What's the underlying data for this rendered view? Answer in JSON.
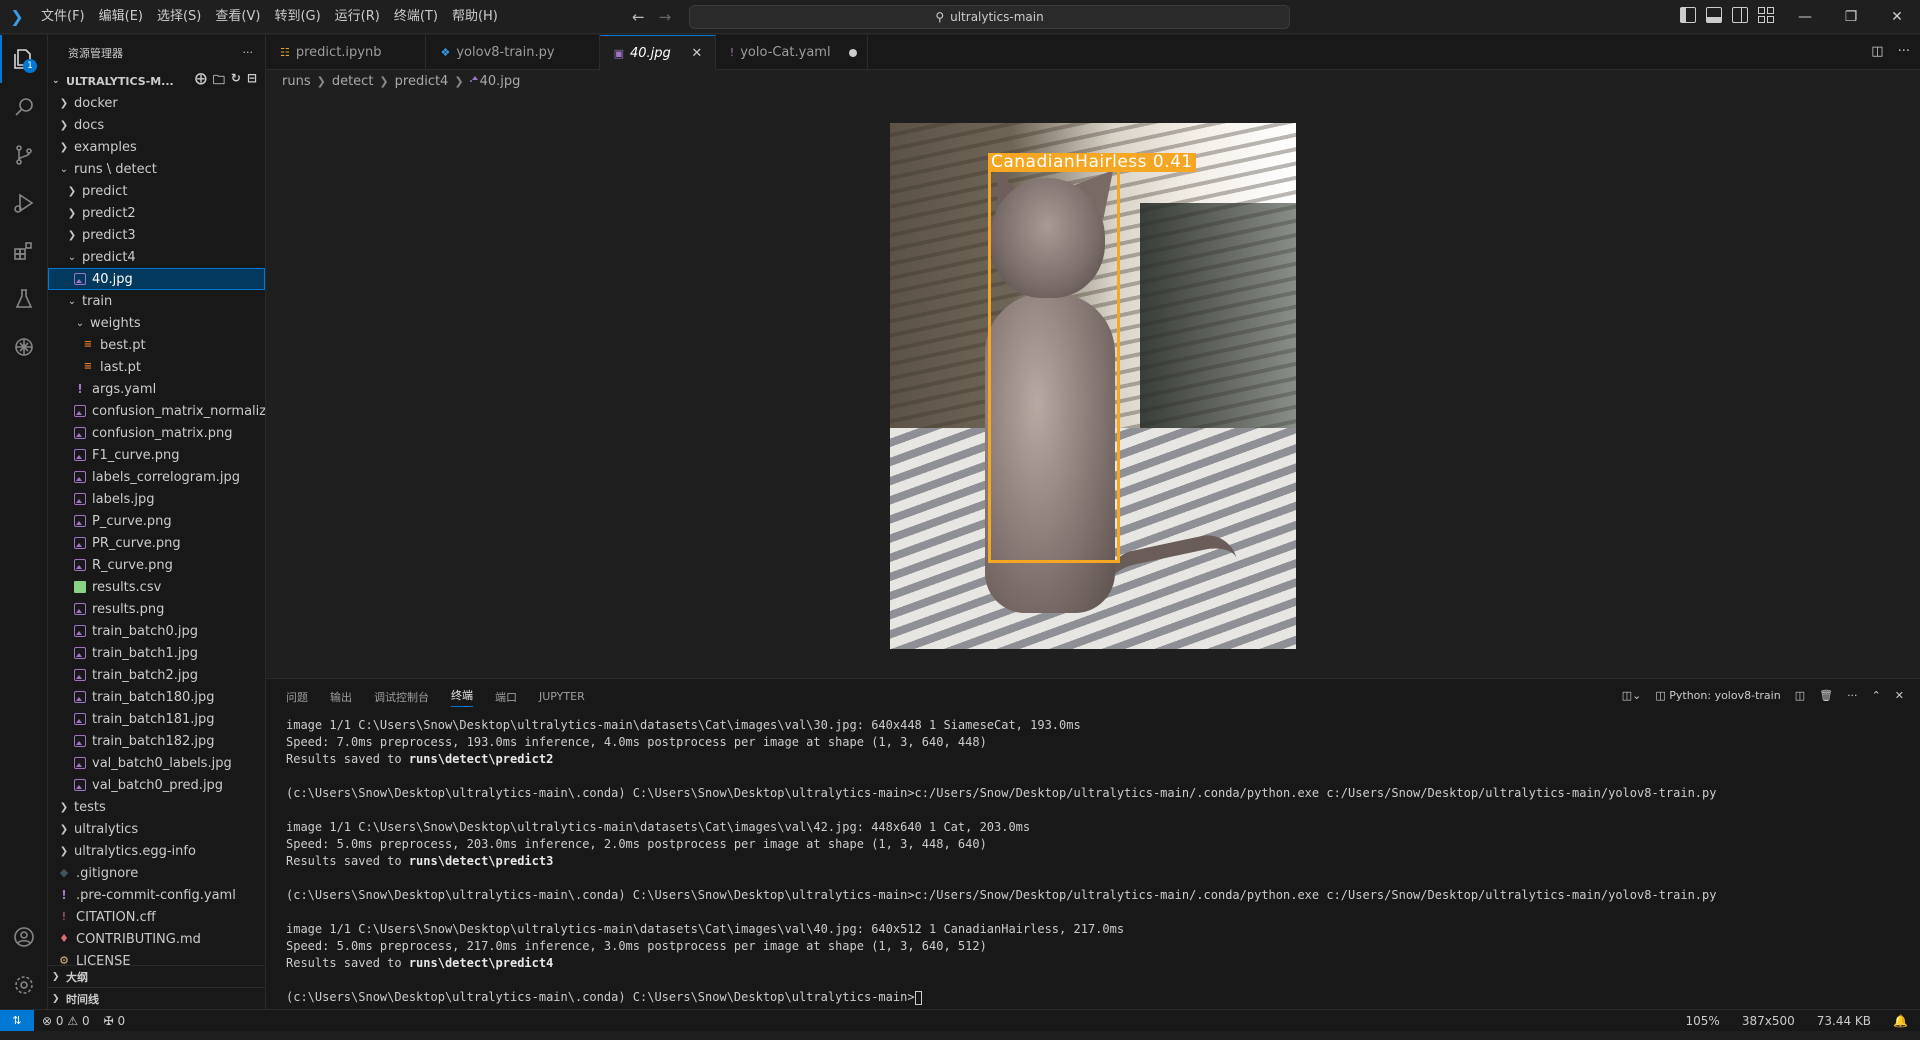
{
  "titlebar": {
    "menu": [
      "文件(F)",
      "编辑(E)",
      "选择(S)",
      "查看(V)",
      "转到(G)",
      "运行(R)",
      "终端(T)",
      "帮助(H)"
    ],
    "search_text": "ultralytics-main"
  },
  "activity": {
    "explorer_badge": "1"
  },
  "sidebar": {
    "header": "资源管理器",
    "root": "ULTRALYTICS-M...",
    "items": [
      {
        "label": "docker",
        "depth": 0,
        "type": "folder",
        "open": false
      },
      {
        "label": "docs",
        "depth": 0,
        "type": "folder",
        "open": false
      },
      {
        "label": "examples",
        "depth": 0,
        "type": "folder",
        "open": false
      },
      {
        "label": "runs \\ detect",
        "depth": 0,
        "type": "folder",
        "open": true
      },
      {
        "label": "predict",
        "depth": 1,
        "type": "folder",
        "open": false
      },
      {
        "label": "predict2",
        "depth": 1,
        "type": "folder",
        "open": false
      },
      {
        "label": "predict3",
        "depth": 1,
        "type": "folder",
        "open": false
      },
      {
        "label": "predict4",
        "depth": 1,
        "type": "folder",
        "open": true
      },
      {
        "label": "40.jpg",
        "depth": 2,
        "type": "img",
        "selected": true
      },
      {
        "label": "train",
        "depth": 1,
        "type": "folder",
        "open": true
      },
      {
        "label": "weights",
        "depth": 2,
        "type": "folder",
        "open": true
      },
      {
        "label": "best.pt",
        "depth": 3,
        "type": "pt"
      },
      {
        "label": "last.pt",
        "depth": 3,
        "type": "pt"
      },
      {
        "label": "args.yaml",
        "depth": 2,
        "type": "yaml"
      },
      {
        "label": "confusion_matrix_normaliz...",
        "depth": 2,
        "type": "img"
      },
      {
        "label": "confusion_matrix.png",
        "depth": 2,
        "type": "img"
      },
      {
        "label": "F1_curve.png",
        "depth": 2,
        "type": "img"
      },
      {
        "label": "labels_correlogram.jpg",
        "depth": 2,
        "type": "img"
      },
      {
        "label": "labels.jpg",
        "depth": 2,
        "type": "img"
      },
      {
        "label": "P_curve.png",
        "depth": 2,
        "type": "img"
      },
      {
        "label": "PR_curve.png",
        "depth": 2,
        "type": "img"
      },
      {
        "label": "R_curve.png",
        "depth": 2,
        "type": "img"
      },
      {
        "label": "results.csv",
        "depth": 2,
        "type": "csv"
      },
      {
        "label": "results.png",
        "depth": 2,
        "type": "img"
      },
      {
        "label": "train_batch0.jpg",
        "depth": 2,
        "type": "img"
      },
      {
        "label": "train_batch1.jpg",
        "depth": 2,
        "type": "img"
      },
      {
        "label": "train_batch2.jpg",
        "depth": 2,
        "type": "img"
      },
      {
        "label": "train_batch180.jpg",
        "depth": 2,
        "type": "img"
      },
      {
        "label": "train_batch181.jpg",
        "depth": 2,
        "type": "img"
      },
      {
        "label": "train_batch182.jpg",
        "depth": 2,
        "type": "img"
      },
      {
        "label": "val_batch0_labels.jpg",
        "depth": 2,
        "type": "img"
      },
      {
        "label": "val_batch0_pred.jpg",
        "depth": 2,
        "type": "img"
      },
      {
        "label": "tests",
        "depth": 0,
        "type": "folder",
        "open": false
      },
      {
        "label": "ultralytics",
        "depth": 0,
        "type": "folder",
        "open": false
      },
      {
        "label": "ultralytics.egg-info",
        "depth": 0,
        "type": "folder",
        "open": false
      },
      {
        "label": ".gitignore",
        "depth": 0,
        "type": "git"
      },
      {
        "label": ".pre-commit-config.yaml",
        "depth": 0,
        "type": "yaml"
      },
      {
        "label": "CITATION.cff",
        "depth": 0,
        "type": "cff"
      },
      {
        "label": "CONTRIBUTING.md",
        "depth": 0,
        "type": "md"
      },
      {
        "label": "LICENSE",
        "depth": 0,
        "type": "lic"
      }
    ],
    "outline": "大纲",
    "timeline": "时间线"
  },
  "tabs": [
    {
      "label": "predict.ipynb",
      "icon": "notebook-icon",
      "active": false,
      "dirty": false
    },
    {
      "label": "yolov8-train.py",
      "icon": "python-icon",
      "active": false,
      "dirty": false
    },
    {
      "label": "40.jpg",
      "icon": "image-icon",
      "active": true,
      "dirty": false
    },
    {
      "label": "yolo-Cat.yaml",
      "icon": "yaml-icon",
      "active": false,
      "dirty": true
    }
  ],
  "breadcrumb": [
    "runs",
    "detect",
    "predict4",
    "40.jpg"
  ],
  "image": {
    "detection_label": "CanadianHairless  0.41",
    "bbox_color": "#f5a623"
  },
  "panel": {
    "tabs": [
      "问题",
      "输出",
      "调试控制台",
      "终端",
      "端口",
      "JUPYTER"
    ],
    "active_tab": "终端",
    "terminal_name": "Python: yolov8-train",
    "lines": [
      {
        "text": "image 1/1 C:\\Users\\Snow\\Desktop\\ultralytics-main\\datasets\\Cat\\images\\val\\30.jpg: 640x448 1 SiameseCat, 193.0ms"
      },
      {
        "text": "Speed: 7.0ms preprocess, 193.0ms inference, 4.0ms postprocess per image at shape (1, 3, 640, 448)"
      },
      {
        "text": "Results saved to ",
        "bold": "runs\\detect\\predict2"
      },
      {
        "text": ""
      },
      {
        "text": "(c:\\Users\\Snow\\Desktop\\ultralytics-main\\.conda) C:\\Users\\Snow\\Desktop\\ultralytics-main>c:/Users/Snow/Desktop/ultralytics-main/.conda/python.exe c:/Users/Snow/Desktop/ultralytics-main/yolov8-train.py"
      },
      {
        "text": ""
      },
      {
        "text": "image 1/1 C:\\Users\\Snow\\Desktop\\ultralytics-main\\datasets\\Cat\\images\\val\\42.jpg: 448x640 1 Cat, 203.0ms"
      },
      {
        "text": "Speed: 5.0ms preprocess, 203.0ms inference, 2.0ms postprocess per image at shape (1, 3, 448, 640)"
      },
      {
        "text": "Results saved to ",
        "bold": "runs\\detect\\predict3"
      },
      {
        "text": ""
      },
      {
        "text": "(c:\\Users\\Snow\\Desktop\\ultralytics-main\\.conda) C:\\Users\\Snow\\Desktop\\ultralytics-main>c:/Users/Snow/Desktop/ultralytics-main/.conda/python.exe c:/Users/Snow/Desktop/ultralytics-main/yolov8-train.py"
      },
      {
        "text": ""
      },
      {
        "text": "image 1/1 C:\\Users\\Snow\\Desktop\\ultralytics-main\\datasets\\Cat\\images\\val\\40.jpg: 640x512 1 CanadianHairless, 217.0ms"
      },
      {
        "text": "Speed: 5.0ms preprocess, 217.0ms inference, 3.0ms postprocess per image at shape (1, 3, 640, 512)"
      },
      {
        "text": "Results saved to ",
        "bold": "runs\\detect\\predict4"
      },
      {
        "text": ""
      },
      {
        "text": "(c:\\Users\\Snow\\Desktop\\ultralytics-main\\.conda) C:\\Users\\Snow\\Desktop\\ultralytics-main>",
        "cursor": true
      }
    ]
  },
  "statusbar": {
    "errors": "0",
    "warnings": "0",
    "ports": "0",
    "zoom": "105%",
    "dimensions": "387x500",
    "filesize": "73.44 KB"
  }
}
